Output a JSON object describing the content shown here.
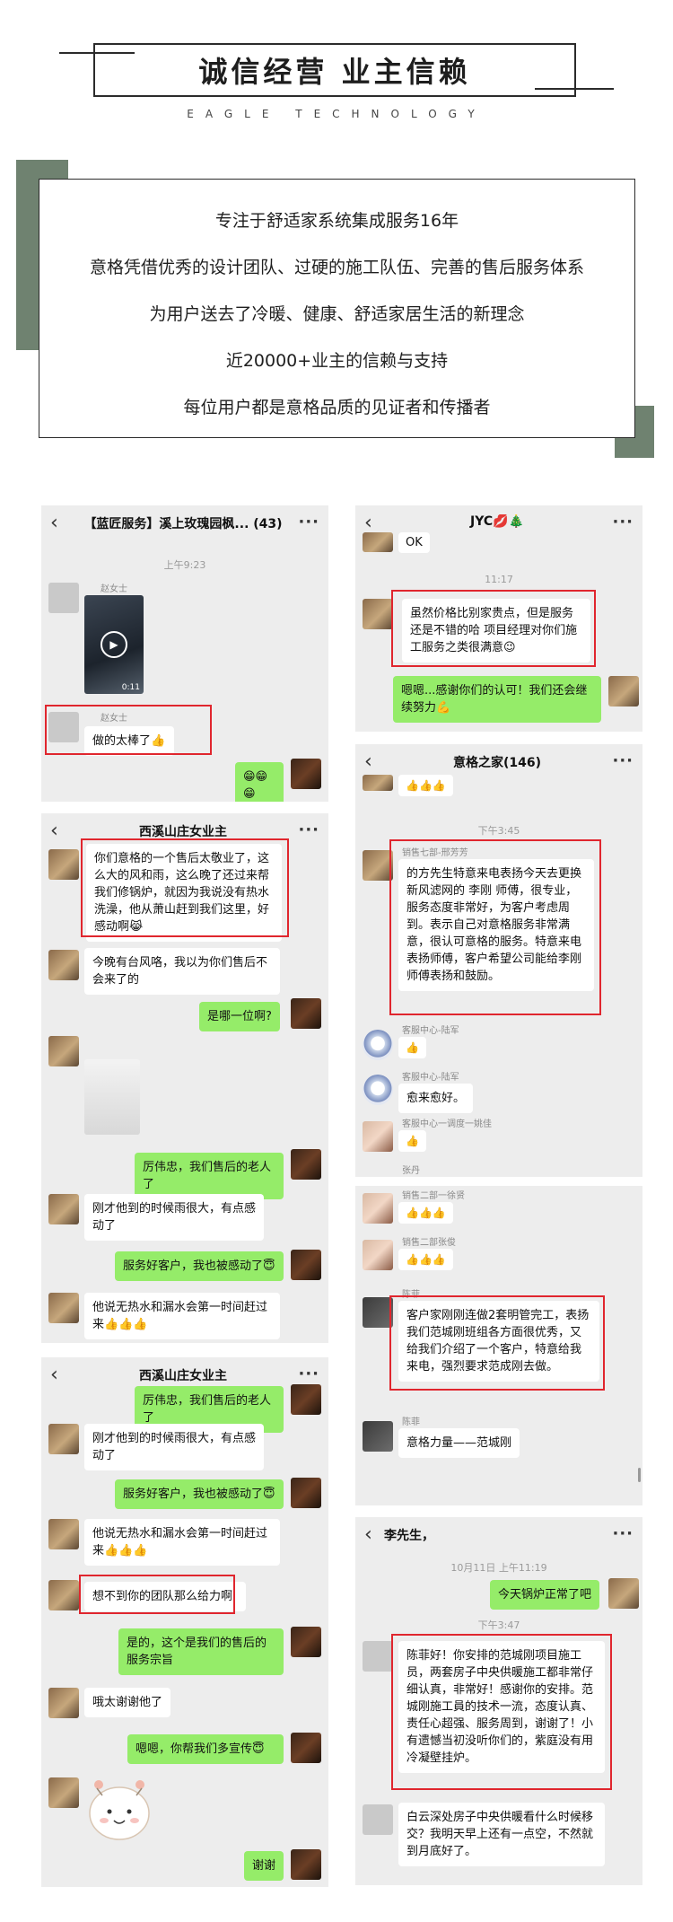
{
  "header": {
    "title": "诚信经营 业主信赖",
    "subtitle": "EAGLE TECHNOLOGY"
  },
  "intro": {
    "lines": [
      "专注于舒适家系统集成服务16年",
      "意格凭借优秀的设计团队、过硬的施工队伍、完善的售后服务体系",
      "为用户送去了冷暖、健康、舒适家居生活的新理念",
      "近20000+业主的信赖与支持",
      "每位用户都是意格品质的见证者和传播者"
    ]
  },
  "icons": {
    "back": "chevron-left-icon",
    "more": "more-icon",
    "play": "play-icon",
    "thumbs": "thumbs-up-emoji"
  },
  "colors": {
    "accent_green": "#6f8270",
    "bubble_me": "#95ec69",
    "highlight_red": "#e0262e"
  },
  "panel1": {
    "title": "【蓝匠服务】溪上玫瑰园枫...",
    "count": "(43)",
    "time": "上午9:23",
    "sender_1": "赵女士",
    "video_duration": "0:11",
    "sender_2": "赵女士",
    "msg_1": "做的太棒了👍",
    "msg_2": "😁😁😁"
  },
  "panel2": {
    "title": "JYC💋🎄",
    "msg_0": "OK",
    "time": "11:17",
    "msg_1": "虽然价格比别家贵点，但是服务还是不错的哈  项目经理对你们施工服务之类很满意😉",
    "msg_2": "嗯嗯...感谢你们的认可！我们还会继续努力💪"
  },
  "panel3": {
    "title": "意格之家(146)",
    "thumbs_1": "👍👍👍",
    "time": "下午3:45",
    "sender_1": "销售七部-邢芳芳",
    "msg_1": "的方先生特意来电表扬今天去更换新风滤网的 李刚 师傅，很专业，服务态度非常好，为客户考虑周到。表示自己对意格服务非常满意，很认可意格的服务。特意来电表扬师傅，客户希望公司能给李刚师傅表扬和鼓励。",
    "sender_2": "客服中心-陆军",
    "thumbs_2": "👍",
    "sender_3": "客服中心-陆军",
    "msg_3": "愈来愈好。",
    "sender_4": "客服中心一调度一姚佳",
    "thumbs_4": "👍",
    "sender_5": "张丹",
    "sender_6": "销售二部一徐贤",
    "thumbs_6": "👍👍👍",
    "sender_7": "销售二部张俊",
    "thumbs_7": "👍👍👍",
    "sender_8": "陈菲",
    "msg_8": "客户家刚刚连做2套明管完工，表扬我们范城刚班组各方面很优秀，又给我们介绍了一个客户，特意给我来电，强烈要求范成刚去做。",
    "sender_9": "陈菲",
    "msg_9": "意格力量——范城刚"
  },
  "panel4": {
    "title": "西溪山庄女业主",
    "msg_1": "你们意格的一个售后太敬业了，这么大的风和雨，这么晚了还过来帮我们修锅炉，就因为我说没有热水洗澡，他从萧山赶到我们这里，好感动啊😹",
    "msg_2": "今晚有台风咯，我以为你们售后不会来了的",
    "msg_3": "是哪一位啊?",
    "msg_4": "厉伟忠，我们售后的老人了",
    "msg_5": "刚才他到的时候雨很大，有点感动了",
    "msg_6": "服务好客户，我也被感动了😇",
    "msg_7": "他说无热水和漏水会第一时间赶过来👍👍👍"
  },
  "panel5": {
    "title": "西溪山庄女业主",
    "msg_1": "厉伟忠，我们售后的老人了",
    "msg_2": "刚才他到的时候雨很大，有点感动了",
    "msg_3": "服务好客户，我也被感动了😇",
    "msg_4": "他说无热水和漏水会第一时间赶过来👍👍👍",
    "msg_5": "想不到你的团队那么给力啊",
    "msg_6": "是的，这个是我们的售后的服务宗旨",
    "msg_7": "哦太谢谢他了",
    "msg_8": "嗯嗯，你帮我们多宣传😇",
    "msg_9": "谢谢"
  },
  "panel6": {
    "title": "李先生，",
    "time_1": "10月11日 上午11:19",
    "msg_1": "今天锅炉正常了吧",
    "time_2": "下午3:47",
    "msg_2": "陈菲好！你安排的范城刚项目施工员，两套房子中央供暖施工都非常仔细认真，非常好！感谢你的安排。范城刚施工員的技术一流，态度认真、责任心超强、服务周到，谢谢了！小有遗憾当初没听你们的，紫庭没有用冷凝壁挂炉。",
    "msg_3": "白云深处房子中央供暖看什么时候移交？我明天早上还有一点空，不然就到月底好了。"
  }
}
